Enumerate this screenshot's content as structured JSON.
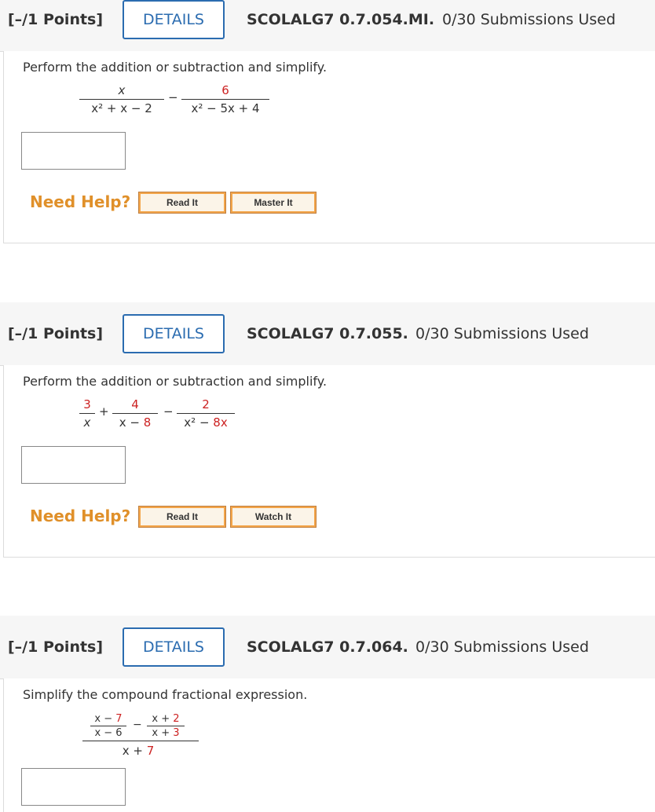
{
  "questions": [
    {
      "points": "[–/1 Points]",
      "details_label": "DETAILS",
      "code": "SCOLALG7 0.7.054.MI.",
      "submissions": "0/30 Submissions Used",
      "prompt": "Perform the addition or subtraction and simplify.",
      "expression": {
        "frac1_num": "x",
        "frac1_den": "x² + x − 2",
        "op": "−",
        "frac2_num": "6",
        "frac2_den": "x² − 5x + 4"
      },
      "need_help": "Need Help?",
      "buttons": [
        "Read It",
        "Master It"
      ]
    },
    {
      "points": "[–/1 Points]",
      "details_label": "DETAILS",
      "code": "SCOLALG7 0.7.055.",
      "submissions": "0/30 Submissions Used",
      "prompt": "Perform the addition or subtraction and simplify.",
      "expression": {
        "frac1_num": "3",
        "frac1_den": "x",
        "op1": "+",
        "frac2_num": "4",
        "frac2_den_a": "x − ",
        "frac2_den_b": "8",
        "op2": "−",
        "frac3_num": "2",
        "frac3_den_a": "x² − ",
        "frac3_den_b": "8x"
      },
      "need_help": "Need Help?",
      "buttons": [
        "Read It",
        "Watch It"
      ]
    },
    {
      "points": "[–/1 Points]",
      "details_label": "DETAILS",
      "code": "SCOLALG7 0.7.064.",
      "submissions": "0/30 Submissions Used",
      "prompt": "Simplify the compound fractional expression.",
      "expression": {
        "a_num_a": "x − ",
        "a_num_b": "7",
        "a_den": "x − 6",
        "op": "−",
        "b_num_a": "x + ",
        "b_num_b": "2",
        "b_den_a": "x + ",
        "b_den_b": "3",
        "outer_den_a": "x + ",
        "outer_den_b": "7"
      }
    }
  ]
}
